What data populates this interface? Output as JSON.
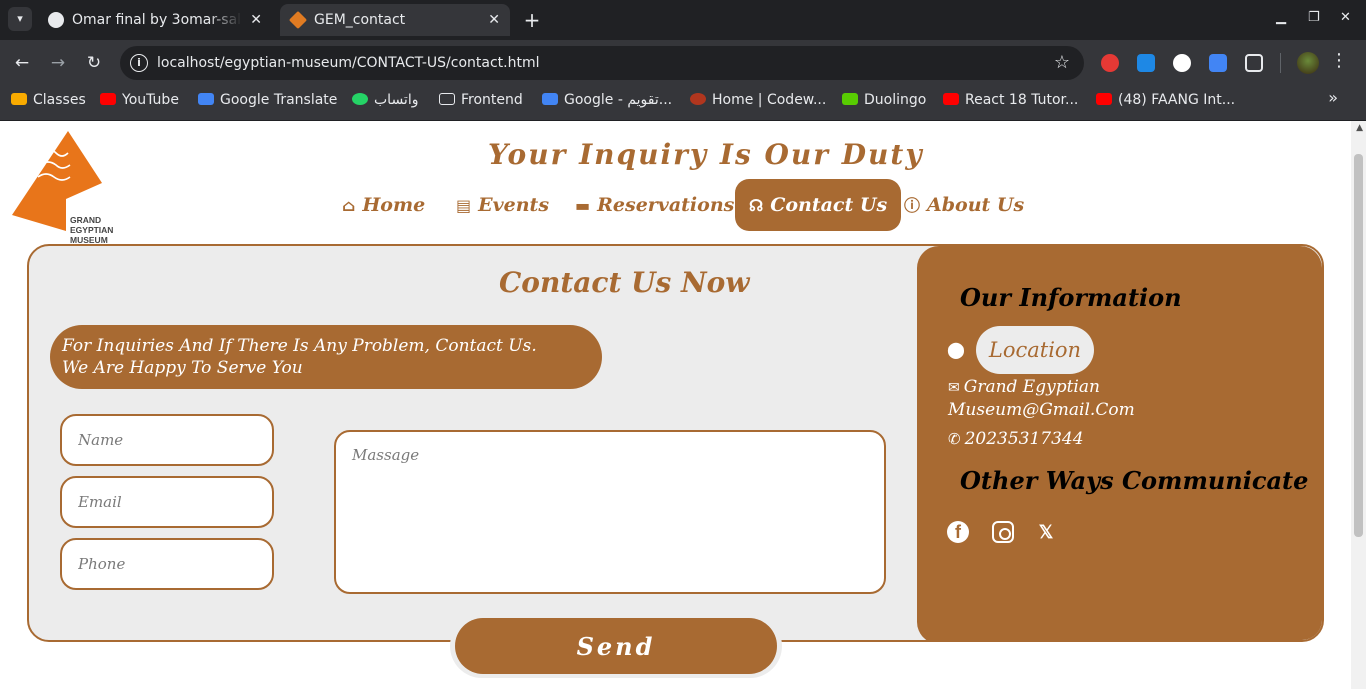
{
  "browser": {
    "tabs": [
      {
        "title": "Omar final by 3omar-salah",
        "close": "✕"
      },
      {
        "title": "GEM_contact",
        "close": "✕"
      }
    ],
    "new_tab": "+",
    "url": "localhost/egyptian-museum/CONTACT-US/contact.html",
    "bookmarks": [
      {
        "label": "Classes",
        "icon": "classroom-icon",
        "color": "#f9ab00"
      },
      {
        "label": "YouTube",
        "icon": "youtube-icon",
        "color": "#ff0000"
      },
      {
        "label": "Google Translate",
        "icon": "translate-icon",
        "color": "#4285f4"
      },
      {
        "label": "واتساب",
        "icon": "whatsapp-icon",
        "color": "#25d366"
      },
      {
        "label": "Frontend",
        "icon": "folder-icon",
        "color": "#35363a"
      },
      {
        "label": "Google - تقويم...",
        "icon": "calendar-icon",
        "color": "#4285f4"
      },
      {
        "label": "Home | Codew...",
        "icon": "codewars-icon",
        "color": "#b1361e"
      },
      {
        "label": "Duolingo",
        "icon": "duolingo-icon",
        "color": "#58cc02"
      },
      {
        "label": "React 18 Tutor...",
        "icon": "youtube-icon",
        "color": "#ff0000"
      },
      {
        "label": "(48) FAANG Int...",
        "icon": "youtube-icon",
        "color": "#ff0000"
      }
    ]
  },
  "site": {
    "logo_lines": [
      "GRAND",
      "EGYPTIAN",
      "MUSEUM"
    ],
    "headline": "Your Inquiry Is Our Duty",
    "nav": [
      {
        "label": "Home",
        "icon": "home-icon",
        "active": false
      },
      {
        "label": "Events",
        "icon": "newspaper-icon",
        "active": false
      },
      {
        "label": "Reservations",
        "icon": "ticket-icon",
        "active": false
      },
      {
        "label": "Contact Us",
        "icon": "headset-icon",
        "active": true
      },
      {
        "label": "About Us",
        "icon": "info-icon",
        "active": false
      }
    ]
  },
  "contact": {
    "title": "Contact Us Now",
    "notice_line1": "For Inquiries And If There Is Any Problem, Contact Us.",
    "notice_line2": "We Are Happy To Serve You",
    "name_placeholder": "Name",
    "email_placeholder": "Email",
    "phone_placeholder": "Phone",
    "message_placeholder": "Massage",
    "send_label": "Send"
  },
  "info": {
    "title": "Our Information",
    "location": "Location",
    "email_line1": "Grand Egyptian",
    "email_line2": "Museum@Gmail.Com",
    "phone": "20235317344",
    "other_title": "Other Ways Communicate",
    "social": [
      "facebook-icon",
      "instagram-icon",
      "x-icon"
    ]
  },
  "colors": {
    "brand": "#a86a32",
    "card_bg": "#ececec",
    "chrome_dark": "#202124",
    "chrome_toolbar": "#35363a"
  }
}
